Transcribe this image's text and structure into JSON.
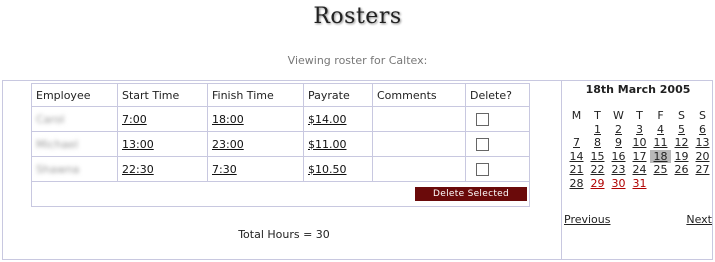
{
  "page": {
    "title": "Rosters",
    "subtitle": "Viewing roster for Caltex:"
  },
  "roster": {
    "headers": [
      "Employee",
      "Start Time",
      "Finish Time",
      "Payrate",
      "Comments",
      "Delete?"
    ],
    "rows": [
      {
        "employee": "Carol",
        "start": "7:00",
        "finish": "18:00",
        "payrate": "$14.00",
        "comments": ""
      },
      {
        "employee": "Michael",
        "start": "13:00",
        "finish": "23:00",
        "payrate": "$11.00",
        "comments": ""
      },
      {
        "employee": "Shawna",
        "start": "22:30",
        "finish": "7:30",
        "payrate": "$10.50",
        "comments": ""
      }
    ],
    "delete_label": "Delete Selected",
    "total_hours": "Total Hours = 30"
  },
  "calendar": {
    "title": "18th March 2005",
    "weekday_headers": [
      "M",
      "T",
      "W",
      "T",
      "F",
      "S",
      "S"
    ],
    "weeks": [
      [
        "",
        "1",
        "2",
        "3",
        "4",
        "5",
        "6"
      ],
      [
        "7",
        "8",
        "9",
        "10",
        "11",
        "12",
        "13"
      ],
      [
        "14",
        "15",
        "16",
        "17",
        "18",
        "19",
        "20"
      ],
      [
        "21",
        "22",
        "23",
        "24",
        "25",
        "26",
        "27"
      ],
      [
        "28",
        "29",
        "30",
        "31",
        "",
        "",
        ""
      ]
    ],
    "selected_day": "18",
    "highlighted_days": [
      "29",
      "30",
      "31"
    ],
    "highlight_color": "#b00000",
    "prev_label": "Previous",
    "next_label": "Next"
  },
  "colors": {
    "delete_button": "#6a0a0a",
    "border": "#c8c8e0"
  }
}
